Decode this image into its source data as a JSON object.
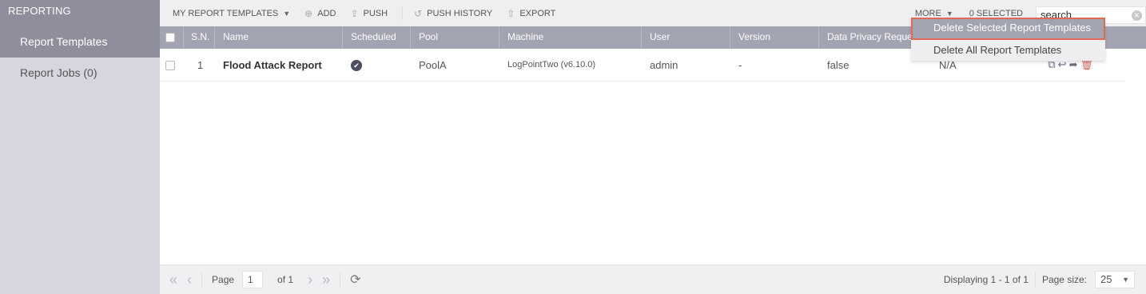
{
  "sidebar": {
    "header": "REPORTING",
    "items": [
      {
        "label": "Report Templates",
        "active": true
      },
      {
        "label": "Report Jobs (0)",
        "active": false
      }
    ]
  },
  "toolbar": {
    "templates_label": "MY REPORT TEMPLATES",
    "add_label": "ADD",
    "push_label": "PUSH",
    "push_history_label": "PUSH HISTORY",
    "export_label": "EXPORT",
    "more_label": "MORE",
    "selected_label": "0 SELECTED",
    "search_value": "search"
  },
  "dropdown": {
    "items": [
      "Delete Selected Report Templates",
      "Delete All Report Templates"
    ]
  },
  "table": {
    "headers": [
      "S.N.",
      "Name",
      "Scheduled",
      "Pool",
      "Machine",
      "User",
      "Version",
      "Data Privacy Reques"
    ],
    "rows": [
      {
        "sn": "1",
        "name": "Flood Attack Report",
        "scheduled": true,
        "pool": "PoolA",
        "machine": "LogPointTwo (v6.10.0)",
        "user": "admin",
        "version": "-",
        "data_privacy": "false",
        "extra": "N/A"
      }
    ]
  },
  "footer": {
    "page_label": "Page",
    "page_value": "1",
    "of_label": "of 1",
    "displaying": "Displaying 1 - 1 of 1",
    "page_size_label": "Page size:",
    "page_size_value": "25"
  },
  "colors": {
    "sidebar_bg": "#d6d6e0",
    "sidebar_active": "#8e8e9c",
    "table_header": "#a3a4b2",
    "dropdown_highlight_border": "#e06a55",
    "delete_icon": "#e0645a"
  }
}
